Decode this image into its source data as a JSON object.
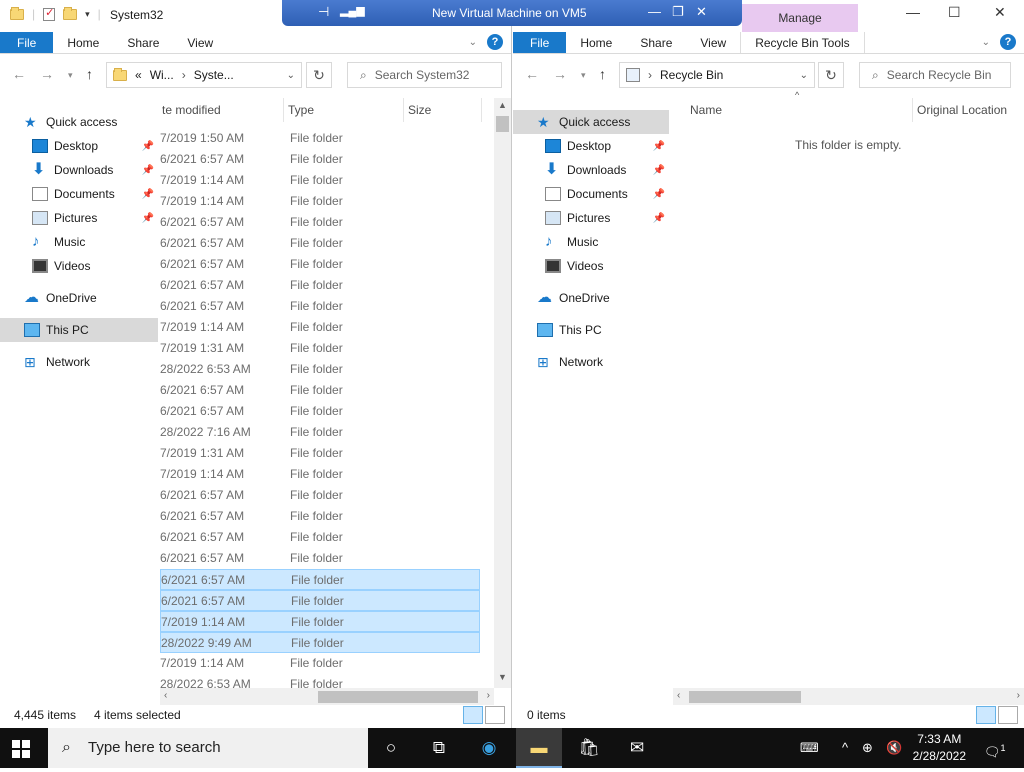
{
  "left_window": {
    "title": "System32",
    "tabs": [
      "File",
      "Home",
      "Share",
      "View"
    ],
    "breadcrumb": [
      "«",
      "Wi...",
      "Syste..."
    ],
    "search_placeholder": "Search System32",
    "columns": [
      "te modified",
      "Type",
      "Size"
    ],
    "nav": [
      {
        "label": "Quick access",
        "icon": "star-icon"
      },
      {
        "label": "Desktop",
        "icon": "desktop-icon",
        "pinned": true
      },
      {
        "label": "Downloads",
        "icon": "downloads-icon",
        "pinned": true
      },
      {
        "label": "Documents",
        "icon": "documents-icon",
        "pinned": true
      },
      {
        "label": "Pictures",
        "icon": "pictures-icon",
        "pinned": true
      },
      {
        "label": "Music",
        "icon": "music-icon"
      },
      {
        "label": "Videos",
        "icon": "videos-icon"
      },
      {
        "label": "OneDrive",
        "icon": "onedrive-icon"
      },
      {
        "label": "This PC",
        "icon": "this-pc-icon",
        "selected": true
      },
      {
        "label": "Network",
        "icon": "network-icon"
      }
    ],
    "rows": [
      {
        "date": "7/2019 1:50 AM",
        "type": "File folder"
      },
      {
        "date": "6/2021 6:57 AM",
        "type": "File folder"
      },
      {
        "date": "7/2019 1:14 AM",
        "type": "File folder"
      },
      {
        "date": "7/2019 1:14 AM",
        "type": "File folder"
      },
      {
        "date": "6/2021 6:57 AM",
        "type": "File folder"
      },
      {
        "date": "6/2021 6:57 AM",
        "type": "File folder"
      },
      {
        "date": "6/2021 6:57 AM",
        "type": "File folder"
      },
      {
        "date": "6/2021 6:57 AM",
        "type": "File folder"
      },
      {
        "date": "6/2021 6:57 AM",
        "type": "File folder"
      },
      {
        "date": "7/2019 1:14 AM",
        "type": "File folder"
      },
      {
        "date": "7/2019 1:31 AM",
        "type": "File folder"
      },
      {
        "date": "28/2022 6:53 AM",
        "type": "File folder"
      },
      {
        "date": "6/2021 6:57 AM",
        "type": "File folder"
      },
      {
        "date": "6/2021 6:57 AM",
        "type": "File folder"
      },
      {
        "date": "28/2022 7:16 AM",
        "type": "File folder"
      },
      {
        "date": "7/2019 1:31 AM",
        "type": "File folder"
      },
      {
        "date": "7/2019 1:14 AM",
        "type": "File folder"
      },
      {
        "date": "6/2021 6:57 AM",
        "type": "File folder"
      },
      {
        "date": "6/2021 6:57 AM",
        "type": "File folder"
      },
      {
        "date": "6/2021 6:57 AM",
        "type": "File folder"
      },
      {
        "date": "6/2021 6:57 AM",
        "type": "File folder"
      },
      {
        "date": "6/2021 6:57 AM",
        "type": "File folder",
        "selected": true
      },
      {
        "date": "6/2021 6:57 AM",
        "type": "File folder",
        "selected": true
      },
      {
        "date": "7/2019 1:14 AM",
        "type": "File folder",
        "selected": true
      },
      {
        "date": "28/2022 9:49 AM",
        "type": "File folder",
        "selected": true
      },
      {
        "date": "7/2019 1:14 AM",
        "type": "File folder"
      },
      {
        "date": "28/2022 6:53 AM",
        "type": "File folder"
      }
    ],
    "status_items": "4,445 items",
    "status_selected": "4 items selected"
  },
  "right_window": {
    "tabs": [
      "File",
      "Home",
      "Share",
      "View",
      "Recycle Bin Tools"
    ],
    "manage_label": "Manage",
    "breadcrumb": "Recycle Bin",
    "search_placeholder": "Search Recycle Bin",
    "columns": [
      "Name",
      "Original Location"
    ],
    "empty_text": "This folder is empty.",
    "nav": [
      {
        "label": "Quick access",
        "icon": "star-icon",
        "selected": true
      },
      {
        "label": "Desktop",
        "icon": "desktop-icon",
        "pinned": true
      },
      {
        "label": "Downloads",
        "icon": "downloads-icon",
        "pinned": true
      },
      {
        "label": "Documents",
        "icon": "documents-icon",
        "pinned": true
      },
      {
        "label": "Pictures",
        "icon": "pictures-icon",
        "pinned": true
      },
      {
        "label": "Music",
        "icon": "music-icon"
      },
      {
        "label": "Videos",
        "icon": "videos-icon"
      },
      {
        "label": "OneDrive",
        "icon": "onedrive-icon"
      },
      {
        "label": "This PC",
        "icon": "this-pc-icon"
      },
      {
        "label": "Network",
        "icon": "network-icon"
      }
    ],
    "status_items": "0 items"
  },
  "vm_bar": {
    "title": "New Virtual Machine on VM5"
  },
  "taskbar": {
    "search_placeholder": "Type here to search",
    "time": "7:33 AM",
    "date": "2/28/2022",
    "notification_count": "1"
  }
}
